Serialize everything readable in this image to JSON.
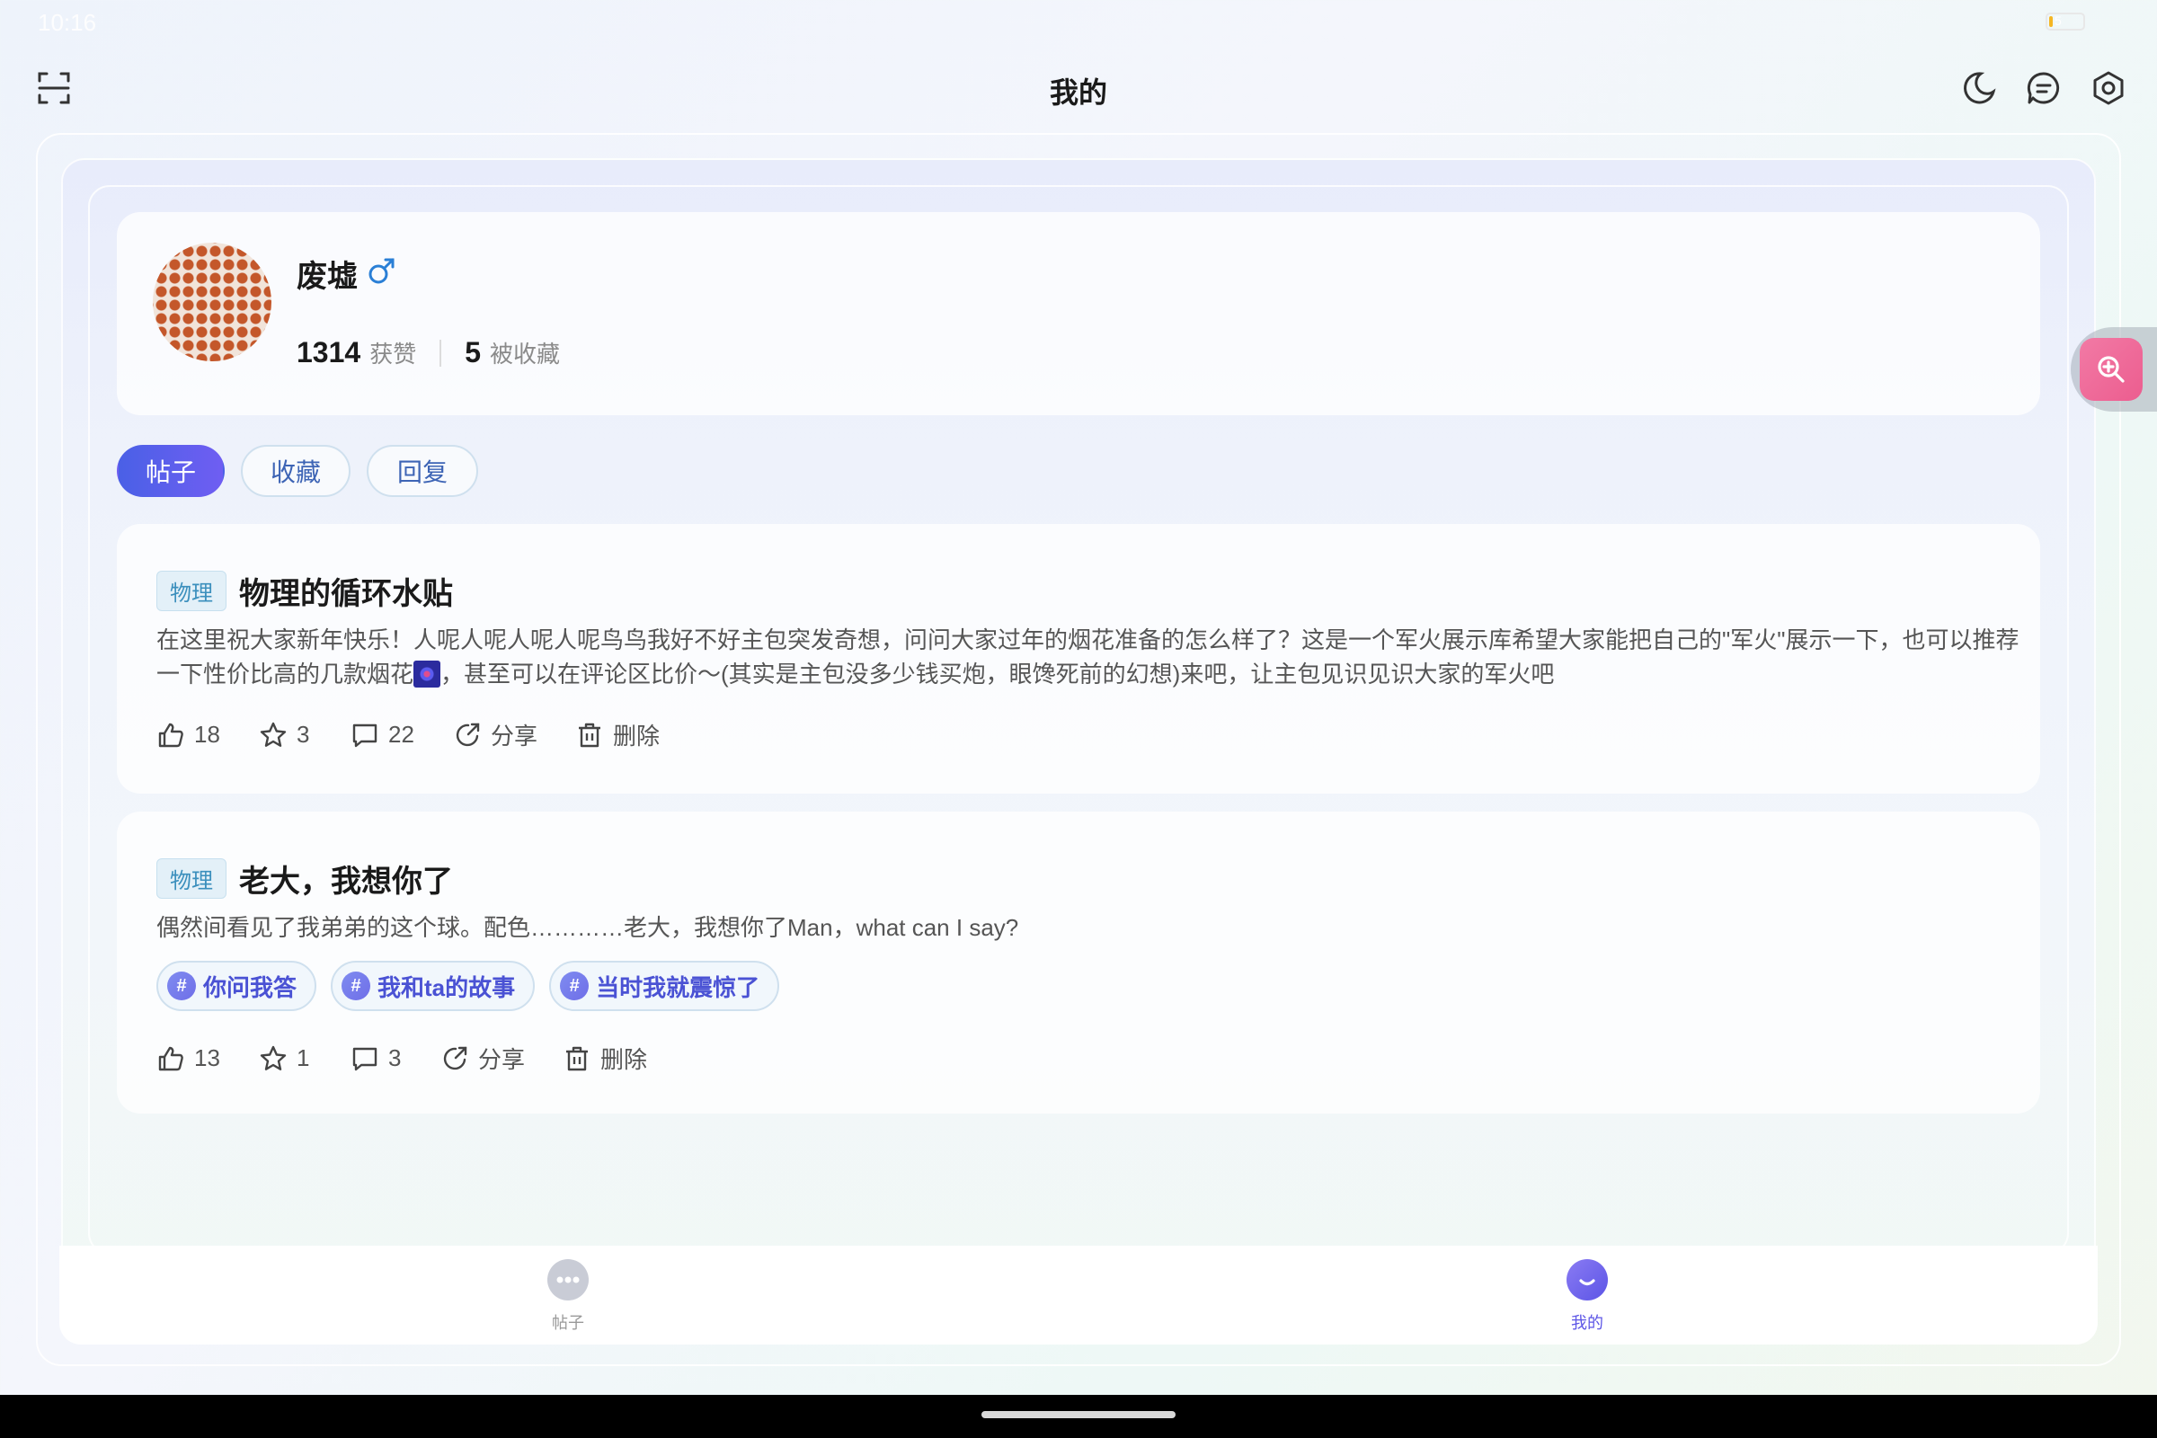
{
  "status_bar": {
    "time": "10:16",
    "battery": "5",
    "battery_level": 0.05
  },
  "header": {
    "title": "我的"
  },
  "icons": {
    "scan": "scan-icon",
    "night_mode": "moon-icon",
    "messages": "message-icon",
    "settings": "settings-icon"
  },
  "profile": {
    "username": "废墟",
    "gender_symbol": "♂",
    "likes_count": "1314",
    "likes_label": "获赞",
    "favorited_count": "5",
    "favorited_label": "被收藏"
  },
  "tabs": [
    {
      "label": "帖子",
      "active": true
    },
    {
      "label": "收藏",
      "active": false
    },
    {
      "label": "回复",
      "active": false
    }
  ],
  "posts": [
    {
      "category": "物理",
      "title": "物理的循环水贴",
      "body_part1": "在这里祝大家新年快乐！人呢人呢人呢人呢鸟鸟我好不好主包突发奇想，问问大家过年的烟花准备的怎么样了？这是一个军火展示库希望大家能把自己的\"军火\"展示一下，也可以推荐一下性价比高的几款烟花",
      "body_part2": "，甚至可以在评论区比价～(其实是主包没多少钱买炮，眼馋死前的幻想)来吧，让主包见识见识大家的军火吧",
      "likes": "18",
      "stars": "3",
      "comments": "22",
      "share_label": "分享",
      "delete_label": "删除",
      "topics": []
    },
    {
      "category": "物理",
      "title": "老大，我想你了",
      "body": "偶然间看见了我弟弟的这个球。配色…………老大，我想你了Man，what can I say?",
      "likes": "13",
      "stars": "1",
      "comments": "3",
      "share_label": "分享",
      "delete_label": "删除",
      "topics": [
        "你问我答",
        "我和ta的故事",
        "当时我就震惊了"
      ]
    }
  ],
  "bottom_nav": [
    {
      "label": "帖子",
      "active": false
    },
    {
      "label": "我的",
      "active": true
    }
  ],
  "topic_hash": "#",
  "colors": {
    "accent": "#5c55e6",
    "tab_active_start": "#4a60e6",
    "tab_active_end": "#6f5ef2",
    "category_tag": "#3b8fbd",
    "topic_text": "#4a52d4",
    "float_button": "#ec5d8f",
    "gender": "#2a7fd6"
  }
}
